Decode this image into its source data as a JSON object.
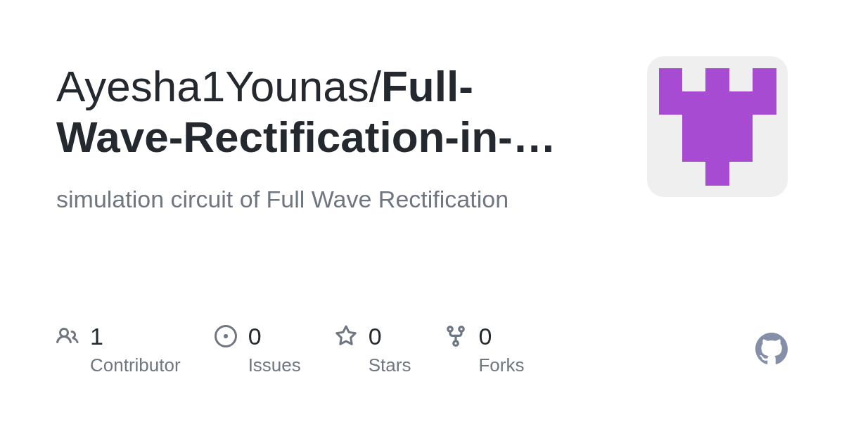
{
  "card": {
    "title": "Ayesha1Younas/**Full-Wave-Rectification-in-…**",
    "description": "simulation circuit of Full Wave Rectification"
  },
  "stats": [
    {
      "kind": "contributors",
      "count": "1",
      "label": "Contributor"
    },
    {
      "kind": "issues",
      "count": "0",
      "label": "Issues"
    },
    {
      "kind": "stars",
      "count": "0",
      "label": "Stars"
    },
    {
      "kind": "forks",
      "count": "0",
      "label": "Forks"
    }
  ]
}
